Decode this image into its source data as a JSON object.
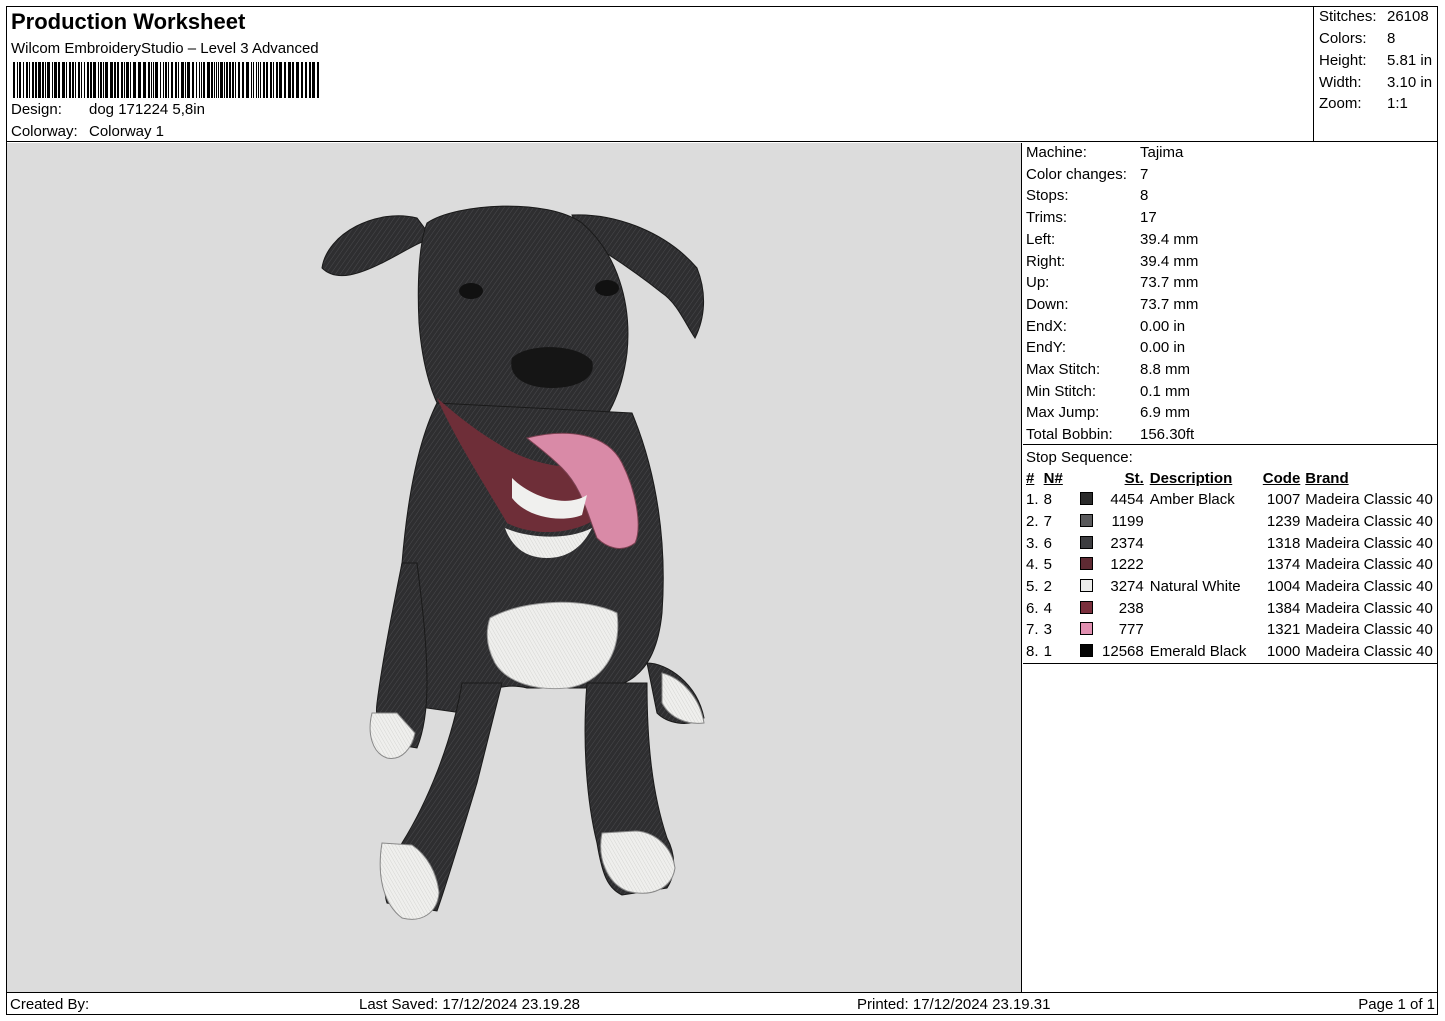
{
  "header": {
    "title": "Production Worksheet",
    "software": "Wilcom EmbroideryStudio – Level 3 Advanced",
    "barcode_icon": "barcode-icon",
    "design_label": "Design:",
    "design_value": "dog 171224 5,8in",
    "colorway_label": "Colorway:",
    "colorway_value": "Colorway 1"
  },
  "stats": [
    {
      "label": "Stitches:",
      "value": "26108"
    },
    {
      "label": "Colors:",
      "value": "8"
    },
    {
      "label": "Height:",
      "value": "5.81 in"
    },
    {
      "label": "Width:",
      "value": "3.10 in"
    },
    {
      "label": "Zoom:",
      "value": "1:1"
    }
  ],
  "machine_info": [
    {
      "label": "Machine:",
      "value": "Tajima"
    },
    {
      "label": "Color changes:",
      "value": "7"
    },
    {
      "label": "Stops:",
      "value": "8"
    },
    {
      "label": "Trims:",
      "value": "17"
    },
    {
      "label": "Left:",
      "value": "39.4 mm"
    },
    {
      "label": "Right:",
      "value": "39.4 mm"
    },
    {
      "label": "Up:",
      "value": "73.7 mm"
    },
    {
      "label": "Down:",
      "value": "73.7 mm"
    },
    {
      "label": "EndX:",
      "value": "0.00 in"
    },
    {
      "label": "EndY:",
      "value": "0.00 in"
    },
    {
      "label": "Max Stitch:",
      "value": "8.8 mm"
    },
    {
      "label": "Min Stitch:",
      "value": "0.1 mm"
    },
    {
      "label": "Max Jump:",
      "value": "6.9 mm"
    },
    {
      "label": "Total Bobbin:",
      "value": "156.30ft"
    }
  ],
  "stop_sequence": {
    "caption": "Stop Sequence:",
    "headers": {
      "idx": "#",
      "n": "N#",
      "st": "St.",
      "desc": "Description",
      "code": "Code",
      "brand": "Brand"
    },
    "rows": [
      {
        "idx": "1.",
        "n": "8",
        "color": "#2b2b2b",
        "st": "4454",
        "desc": "Amber Black",
        "code": "1007",
        "brand": "Madeira Classic 40"
      },
      {
        "idx": "2.",
        "n": "7",
        "color": "#5a5a5c",
        "st": "1199",
        "desc": "",
        "code": "1239",
        "brand": "Madeira Classic 40"
      },
      {
        "idx": "3.",
        "n": "6",
        "color": "#3d3d40",
        "st": "2374",
        "desc": "",
        "code": "1318",
        "brand": "Madeira Classic 40"
      },
      {
        "idx": "4.",
        "n": "5",
        "color": "#5e2a33",
        "st": "1222",
        "desc": "",
        "code": "1374",
        "brand": "Madeira Classic 40"
      },
      {
        "idx": "5.",
        "n": "2",
        "color": "#ececea",
        "st": "3274",
        "desc": "Natural White",
        "code": "1004",
        "brand": "Madeira Classic 40"
      },
      {
        "idx": "6.",
        "n": "4",
        "color": "#7a2f3c",
        "st": "238",
        "desc": "",
        "code": "1384",
        "brand": "Madeira Classic 40"
      },
      {
        "idx": "7.",
        "n": "3",
        "color": "#e08fb0",
        "st": "777",
        "desc": "",
        "code": "1321",
        "brand": "Madeira Classic 40"
      },
      {
        "idx": "8.",
        "n": "1",
        "color": "#050505",
        "st": "12568",
        "desc": "Emerald Black",
        "code": "1000",
        "brand": "Madeira Classic 40"
      }
    ]
  },
  "preview": {
    "icon": "dog-embroidery-image",
    "background": "#dcdcdc"
  },
  "footer": {
    "created_by": "Created By:",
    "last_saved": "Last Saved: 17/12/2024 23.19.28",
    "printed": "Printed: 17/12/2024 23.19.31",
    "page": "Page 1 of 1"
  }
}
